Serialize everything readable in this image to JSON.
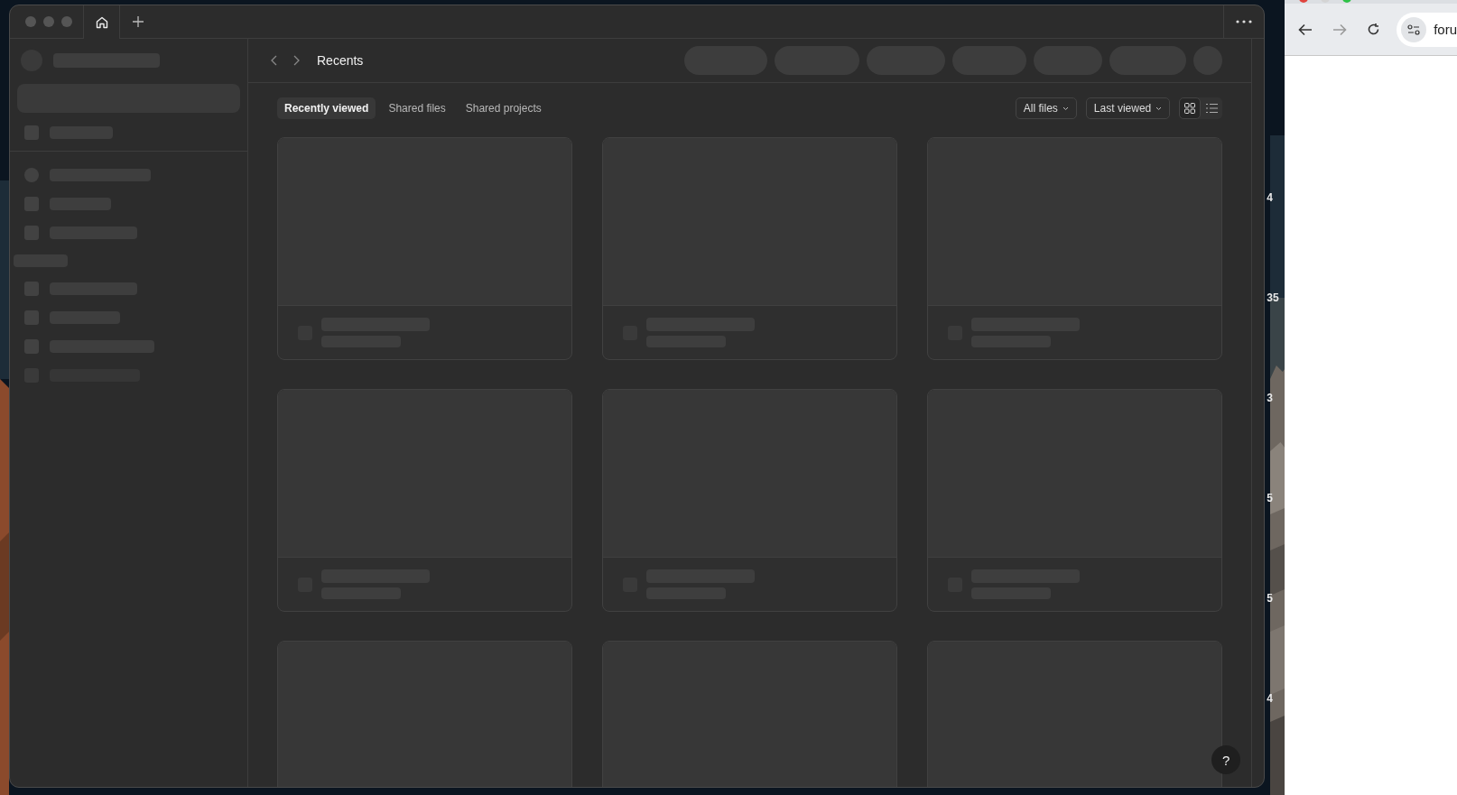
{
  "app_window": {
    "header": {
      "title": "Recents"
    },
    "tabs": [
      {
        "label": "Recently viewed",
        "selected": true
      },
      {
        "label": "Shared files",
        "selected": false
      },
      {
        "label": "Shared projects",
        "selected": false
      }
    ],
    "filters": [
      {
        "label": "All files"
      },
      {
        "label": "Last viewed"
      }
    ],
    "view_toggle": [
      {
        "kind": "grid",
        "selected": true
      },
      {
        "kind": "list",
        "selected": false
      }
    ],
    "help_button": "?"
  },
  "desktop": {
    "widget_numbers": [
      "4",
      "35",
      "3",
      "5",
      "5",
      "4"
    ]
  },
  "browser": {
    "address_text": "foru"
  }
}
